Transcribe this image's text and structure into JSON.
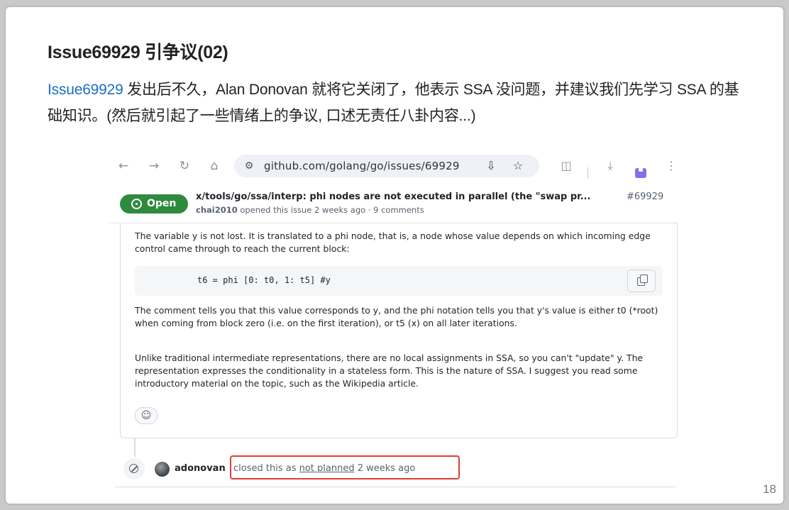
{
  "slide": {
    "title": "Issue69929 引争议(02)",
    "body_link": "Issue69929",
    "body_text": " 发出后不久，Alan Donovan 就将它关闭了，他表示 SSA 没问题，并建议我们先学习 SSA 的基础知识。(然后就引起了一些情绪上的争议, 口述无责任八卦内容...)",
    "page_number": "18"
  },
  "browser": {
    "url": "github.com/golang/go/issues/69929",
    "icons": {
      "back": "arrow-left-icon",
      "forward": "arrow-right-icon",
      "reload": "reload-icon",
      "home": "home-icon",
      "site_info": "tune-icon",
      "install": "install-app-icon",
      "bookmark": "star-icon",
      "extensions": "puzzle-icon",
      "downloads": "download-icon",
      "ext": "bookmark-extension-icon",
      "menu": "more-vert-icon"
    }
  },
  "issue": {
    "status": "Open",
    "status_color": "#2d8a3e",
    "title": "x/tools/go/ssa/interp: phi nodes are not executed in parallel (the \"swap pr...",
    "number": "#69929",
    "author": "chai2010",
    "meta": " opened this issue 2 weeks ago · 9 comments"
  },
  "comment": {
    "para1": "The variable y is not lost. It is translated to a phi node, that is, a node whose value depends on which incoming edge control came through to reach the current block:",
    "code": "t6 = phi [0: t0, 1: t5] #y",
    "para2": "The comment tells you that this value corresponds to y, and the phi notation tells you that y's value is either t0 (*root) when coming from block zero (i.e. on the first iteration), or t5 (x) on all later iterations.",
    "para3": "Unlike traditional intermediate representations, there are no local assignments in SSA, so you can't \"update\" y. The representation expresses the conditionality in a stateless form. This is the nature of SSA. I suggest you read some introductory material on the topic, such as the Wikipedia article."
  },
  "event": {
    "user": "adonovan",
    "text_before": "closed this as ",
    "reason": "not planned",
    "text_after": " 2 weeks ago",
    "highlight_color": "#e23b3b"
  }
}
